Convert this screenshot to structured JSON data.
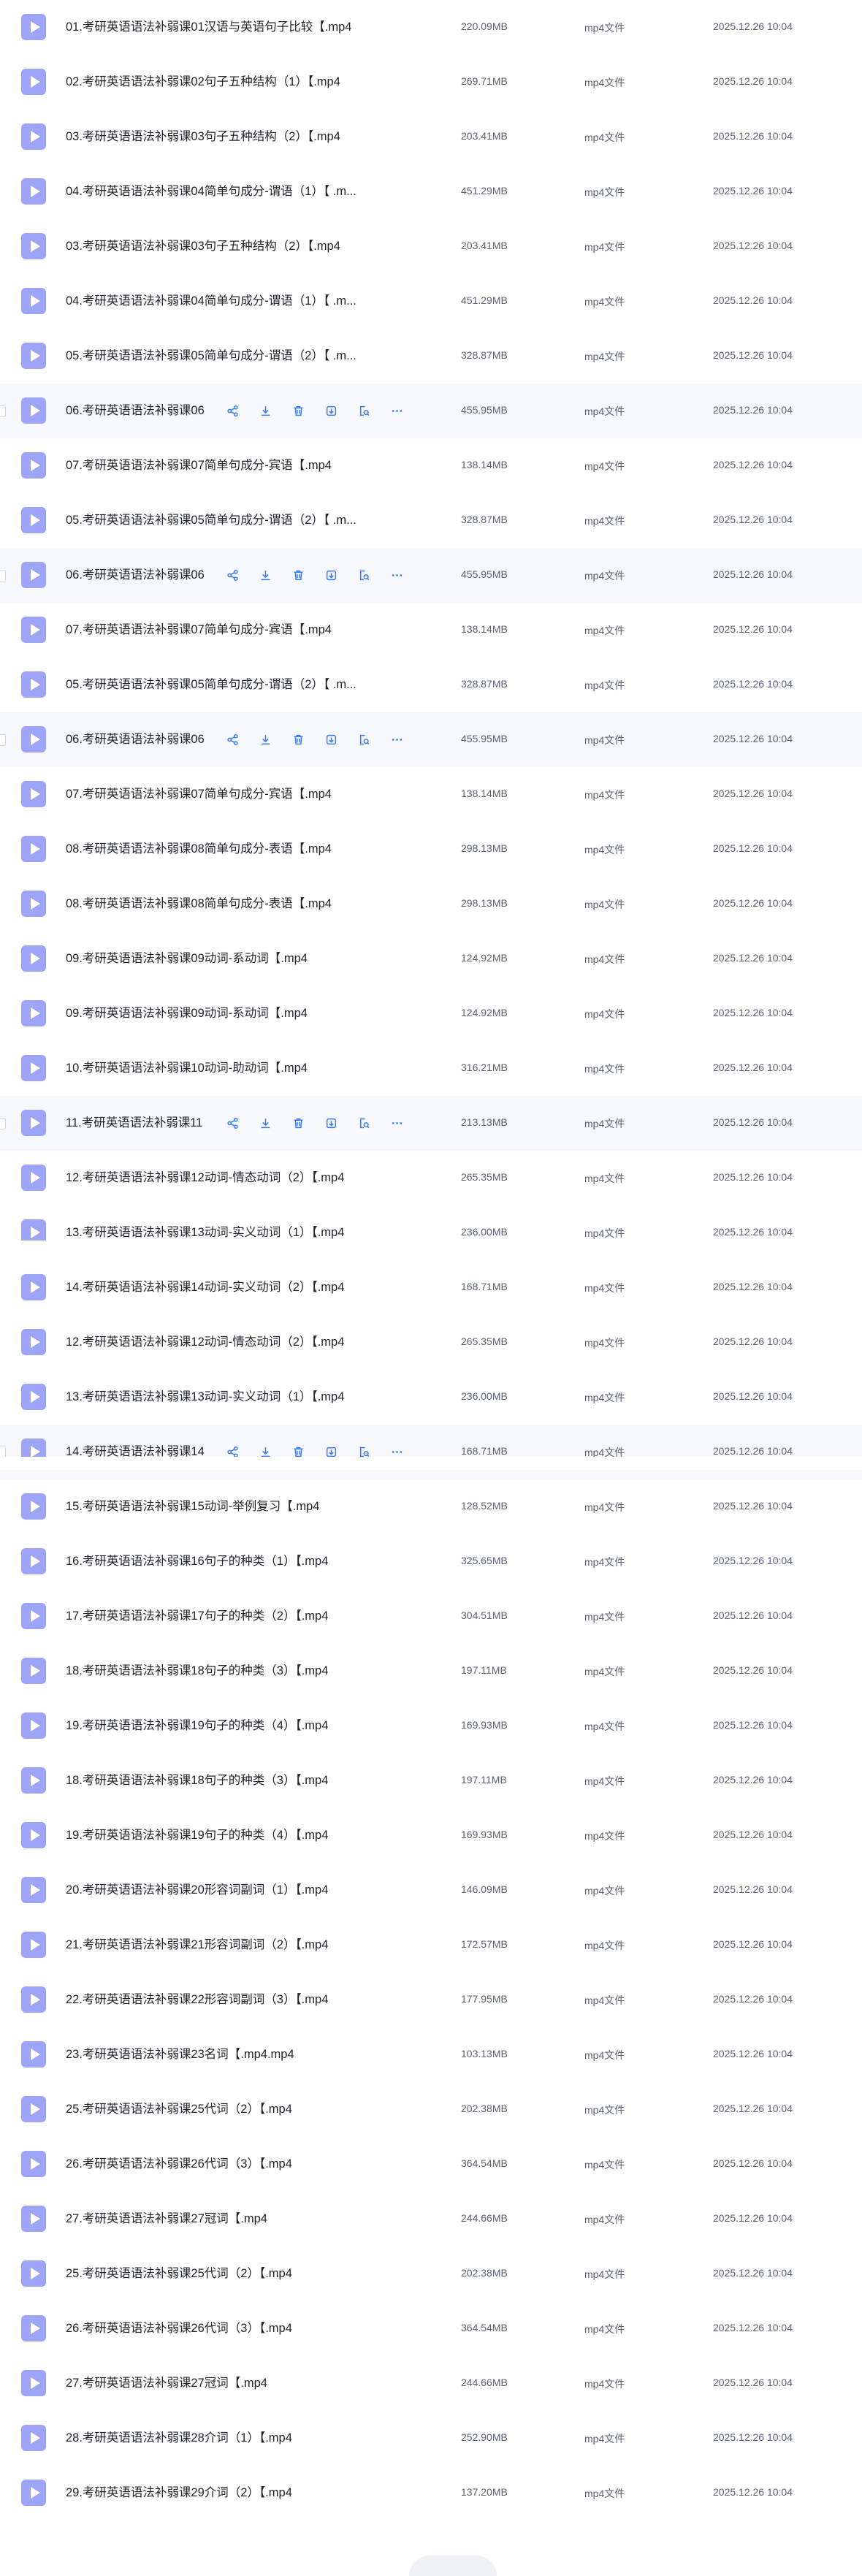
{
  "files": [
    {
      "name": "01.考研英语语法补弱课01汉语与英语句子比较【.mp4",
      "size": "220.09MB",
      "type": "mp4文件",
      "date": "2025.12.26 10:04",
      "hover": false
    },
    {
      "name": "02.考研英语语法补弱课02句子五种结构（1）【.mp4",
      "size": "269.71MB",
      "type": "mp4文件",
      "date": "2025.12.26 10:04",
      "hover": false
    },
    {
      "name": "03.考研英语语法补弱课03句子五种结构（2）【.mp4",
      "size": "203.41MB",
      "type": "mp4文件",
      "date": "2025.12.26 10:04",
      "hover": false
    },
    {
      "name": "04.考研英语语法补弱课04简单句成分-谓语（1）【 .m...",
      "size": "451.29MB",
      "type": "mp4文件",
      "date": "2025.12.26 10:04",
      "hover": false
    },
    {
      "name": "03.考研英语语法补弱课03句子五种结构（2）【.mp4",
      "size": "203.41MB",
      "type": "mp4文件",
      "date": "2025.12.26 10:04",
      "hover": false
    },
    {
      "name": "04.考研英语语法补弱课04简单句成分-谓语（1）【 .m...",
      "size": "451.29MB",
      "type": "mp4文件",
      "date": "2025.12.26 10:04",
      "hover": false
    },
    {
      "name": "05.考研英语语法补弱课05简单句成分-谓语（2）【 .m...",
      "size": "328.87MB",
      "type": "mp4文件",
      "date": "2025.12.26 10:04",
      "hover": false
    },
    {
      "name": "06.考研英语语法补弱课06",
      "size": "455.95MB",
      "type": "mp4文件",
      "date": "2025.12.26 10:04",
      "hover": true
    },
    {
      "name": "07.考研英语语法补弱课07简单句成分-宾语【.mp4",
      "size": "138.14MB",
      "type": "mp4文件",
      "date": "2025.12.26 10:04",
      "hover": false
    },
    {
      "name": "05.考研英语语法补弱课05简单句成分-谓语（2）【 .m...",
      "size": "328.87MB",
      "type": "mp4文件",
      "date": "2025.12.26 10:04",
      "hover": false
    },
    {
      "name": "06.考研英语语法补弱课06",
      "size": "455.95MB",
      "type": "mp4文件",
      "date": "2025.12.26 10:04",
      "hover": true
    },
    {
      "name": "07.考研英语语法补弱课07简单句成分-宾语【.mp4",
      "size": "138.14MB",
      "type": "mp4文件",
      "date": "2025.12.26 10:04",
      "hover": false
    },
    {
      "name": "05.考研英语语法补弱课05简单句成分-谓语（2）【 .m...",
      "size": "328.87MB",
      "type": "mp4文件",
      "date": "2025.12.26 10:04",
      "hover": false
    },
    {
      "name": "06.考研英语语法补弱课06",
      "size": "455.95MB",
      "type": "mp4文件",
      "date": "2025.12.26 10:04",
      "hover": true
    },
    {
      "name": "07.考研英语语法补弱课07简单句成分-宾语【.mp4",
      "size": "138.14MB",
      "type": "mp4文件",
      "date": "2025.12.26 10:04",
      "hover": false
    },
    {
      "name": "08.考研英语语法补弱课08简单句成分-表语【.mp4",
      "size": "298.13MB",
      "type": "mp4文件",
      "date": "2025.12.26 10:04",
      "hover": false
    },
    {
      "name": "08.考研英语语法补弱课08简单句成分-表语【.mp4",
      "size": "298.13MB",
      "type": "mp4文件",
      "date": "2025.12.26 10:04",
      "hover": false
    },
    {
      "name": "09.考研英语语法补弱课09动词-系动词【.mp4",
      "size": "124.92MB",
      "type": "mp4文件",
      "date": "2025.12.26 10:04",
      "hover": false
    },
    {
      "name": "09.考研英语语法补弱课09动词-系动词【.mp4",
      "size": "124.92MB",
      "type": "mp4文件",
      "date": "2025.12.26 10:04",
      "hover": false
    },
    {
      "name": "10.考研英语语法补弱课10动词-助动词【.mp4",
      "size": "316.21MB",
      "type": "mp4文件",
      "date": "2025.12.26 10:04",
      "hover": false
    },
    {
      "name": "11.考研英语语法补弱课11",
      "size": "213.13MB",
      "type": "mp4文件",
      "date": "2025.12.26 10:04",
      "hover": true
    },
    {
      "name": "12.考研英语语法补弱课12动词-情态动词（2）【.mp4",
      "size": "265.35MB",
      "type": "mp4文件",
      "date": "2025.12.26 10:04",
      "hover": false
    },
    {
      "name": "13.考研英语语法补弱课13动词-实义动词（1）【.mp4",
      "size": "236.00MB",
      "type": "mp4文件",
      "date": "2025.12.26 10:04",
      "hover": false
    },
    {
      "name": "14.考研英语语法补弱课14动词-实义动词（2）【.mp4",
      "size": "168.71MB",
      "type": "mp4文件",
      "date": "2025.12.26 10:04",
      "hover": false
    },
    {
      "name": "12.考研英语语法补弱课12动词-情态动词（2）【.mp4",
      "size": "265.35MB",
      "type": "mp4文件",
      "date": "2025.12.26 10:04",
      "hover": false
    },
    {
      "name": "13.考研英语语法补弱课13动词-实义动词（1）【.mp4",
      "size": "236.00MB",
      "type": "mp4文件",
      "date": "2025.12.26 10:04",
      "hover": false
    },
    {
      "name": "14.考研英语语法补弱课14",
      "size": "168.71MB",
      "type": "mp4文件",
      "date": "2025.12.26 10:04",
      "hover": true
    },
    {
      "name": "15.考研英语语法补弱课15动词-举例复习【.mp4",
      "size": "128.52MB",
      "type": "mp4文件",
      "date": "2025.12.26 10:04",
      "hover": false
    },
    {
      "name": "16.考研英语语法补弱课16句子的种类（1）【.mp4",
      "size": "325.65MB",
      "type": "mp4文件",
      "date": "2025.12.26 10:04",
      "hover": false
    },
    {
      "name": "17.考研英语语法补弱课17句子的种类（2）【.mp4",
      "size": "304.51MB",
      "type": "mp4文件",
      "date": "2025.12.26 10:04",
      "hover": false
    },
    {
      "name": "18.考研英语语法补弱课18句子的种类（3）【.mp4",
      "size": "197.11MB",
      "type": "mp4文件",
      "date": "2025.12.26 10:04",
      "hover": false
    },
    {
      "name": "19.考研英语语法补弱课19句子的种类（4）【.mp4",
      "size": "169.93MB",
      "type": "mp4文件",
      "date": "2025.12.26 10:04",
      "hover": false
    },
    {
      "name": "18.考研英语语法补弱课18句子的种类（3）【.mp4",
      "size": "197.11MB",
      "type": "mp4文件",
      "date": "2025.12.26 10:04",
      "hover": false
    },
    {
      "name": "19.考研英语语法补弱课19句子的种类（4）【.mp4",
      "size": "169.93MB",
      "type": "mp4文件",
      "date": "2025.12.26 10:04",
      "hover": false
    },
    {
      "name": "20.考研英语语法补弱课20形容词副词（1）【.mp4",
      "size": "146.09MB",
      "type": "mp4文件",
      "date": "2025.12.26 10:04",
      "hover": false
    },
    {
      "name": "21.考研英语语法补弱课21形容词副词（2）【.mp4",
      "size": "172.57MB",
      "type": "mp4文件",
      "date": "2025.12.26 10:04",
      "hover": false
    },
    {
      "name": "22.考研英语语法补弱课22形容词副词（3）【.mp4",
      "size": "177.95MB",
      "type": "mp4文件",
      "date": "2025.12.26 10:04",
      "hover": false
    },
    {
      "name": "23.考研英语语法补弱课23名词【.mp4.mp4",
      "size": "103.13MB",
      "type": "mp4文件",
      "date": "2025.12.26 10:04",
      "hover": false
    },
    {
      "name": "25.考研英语语法补弱课25代词（2）【.mp4",
      "size": "202.38MB",
      "type": "mp4文件",
      "date": "2025.12.26 10:04",
      "hover": false
    },
    {
      "name": "26.考研英语语法补弱课26代词（3）【.mp4",
      "size": "364.54MB",
      "type": "mp4文件",
      "date": "2025.12.26 10:04",
      "hover": false
    },
    {
      "name": "27.考研英语语法补弱课27冠词【.mp4",
      "size": "244.66MB",
      "type": "mp4文件",
      "date": "2025.12.26 10:04",
      "hover": false
    },
    {
      "name": "25.考研英语语法补弱课25代词（2）【.mp4",
      "size": "202.38MB",
      "type": "mp4文件",
      "date": "2025.12.26 10:04",
      "hover": false
    },
    {
      "name": "26.考研英语语法补弱课26代词（3）【.mp4",
      "size": "364.54MB",
      "type": "mp4文件",
      "date": "2025.12.26 10:04",
      "hover": false
    },
    {
      "name": "27.考研英语语法补弱课27冠词【.mp4",
      "size": "244.66MB",
      "type": "mp4文件",
      "date": "2025.12.26 10:04",
      "hover": false
    },
    {
      "name": "28.考研英语语法补弱课28介词（1）【.mp4",
      "size": "252.90MB",
      "type": "mp4文件",
      "date": "2025.12.26 10:04",
      "hover": false
    },
    {
      "name": "29.考研英语语法补弱课29介词（2）【.mp4",
      "size": "137.20MB",
      "type": "mp4文件",
      "date": "2025.12.26 10:04",
      "hover": false
    }
  ],
  "row_actions": [
    {
      "name": "share-icon"
    },
    {
      "name": "download-icon"
    },
    {
      "name": "delete-icon"
    },
    {
      "name": "move-icon"
    },
    {
      "name": "search-file-icon"
    },
    {
      "name": "more-icon"
    }
  ],
  "colors": {
    "file_icon": "#9ea4f7",
    "action": "#3a7af0",
    "hover_row": "#f6f8fc",
    "text": "#1f2329",
    "meta": "#5a6170"
  }
}
